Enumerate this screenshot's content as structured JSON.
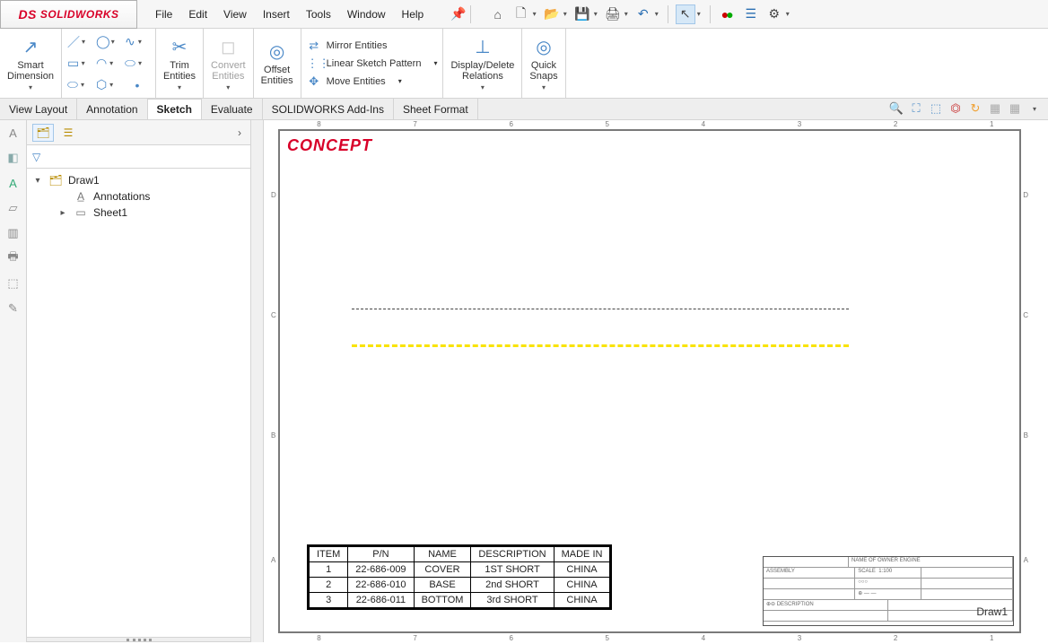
{
  "app": {
    "name": "SOLIDWORKS"
  },
  "menu": {
    "file": "File",
    "edit": "Edit",
    "view": "View",
    "insert": "Insert",
    "tools": "Tools",
    "window": "Window",
    "help": "Help"
  },
  "ribbon": {
    "smartdim": "Smart\nDimension",
    "trim": "Trim\nEntities",
    "convert": "Convert\nEntities",
    "offset": "Offset\nEntities",
    "mirror": "Mirror Entities",
    "linear": "Linear Sketch Pattern",
    "move": "Move Entities",
    "display": "Display/Delete\nRelations",
    "quick": "Quick\nSnaps"
  },
  "tabs": {
    "viewlayout": "View Layout",
    "annotation": "Annotation",
    "sketch": "Sketch",
    "evaluate": "Evaluate",
    "addins": "SOLIDWORKS Add-Ins",
    "sheetformat": "Sheet Format"
  },
  "tree": {
    "root": "Draw1",
    "annotations": "Annotations",
    "sheet": "Sheet1"
  },
  "drawing": {
    "stamp": "CONCEPT",
    "titleblock_name": "Draw1",
    "bom_headers": [
      "ITEM",
      "P/N",
      "NAME",
      "DESCRIPTION",
      "MADE IN"
    ],
    "bom": [
      {
        "item": "1",
        "pn": "22-686-009",
        "name": "COVER",
        "desc": "1ST SHORT",
        "made": "CHINA"
      },
      {
        "item": "2",
        "pn": "22-686-010",
        "name": "BASE",
        "desc": "2nd SHORT",
        "made": "CHINA"
      },
      {
        "item": "3",
        "pn": "22-686-011",
        "name": "BOTTOM",
        "desc": "3rd SHORT",
        "made": "CHINA"
      }
    ]
  }
}
